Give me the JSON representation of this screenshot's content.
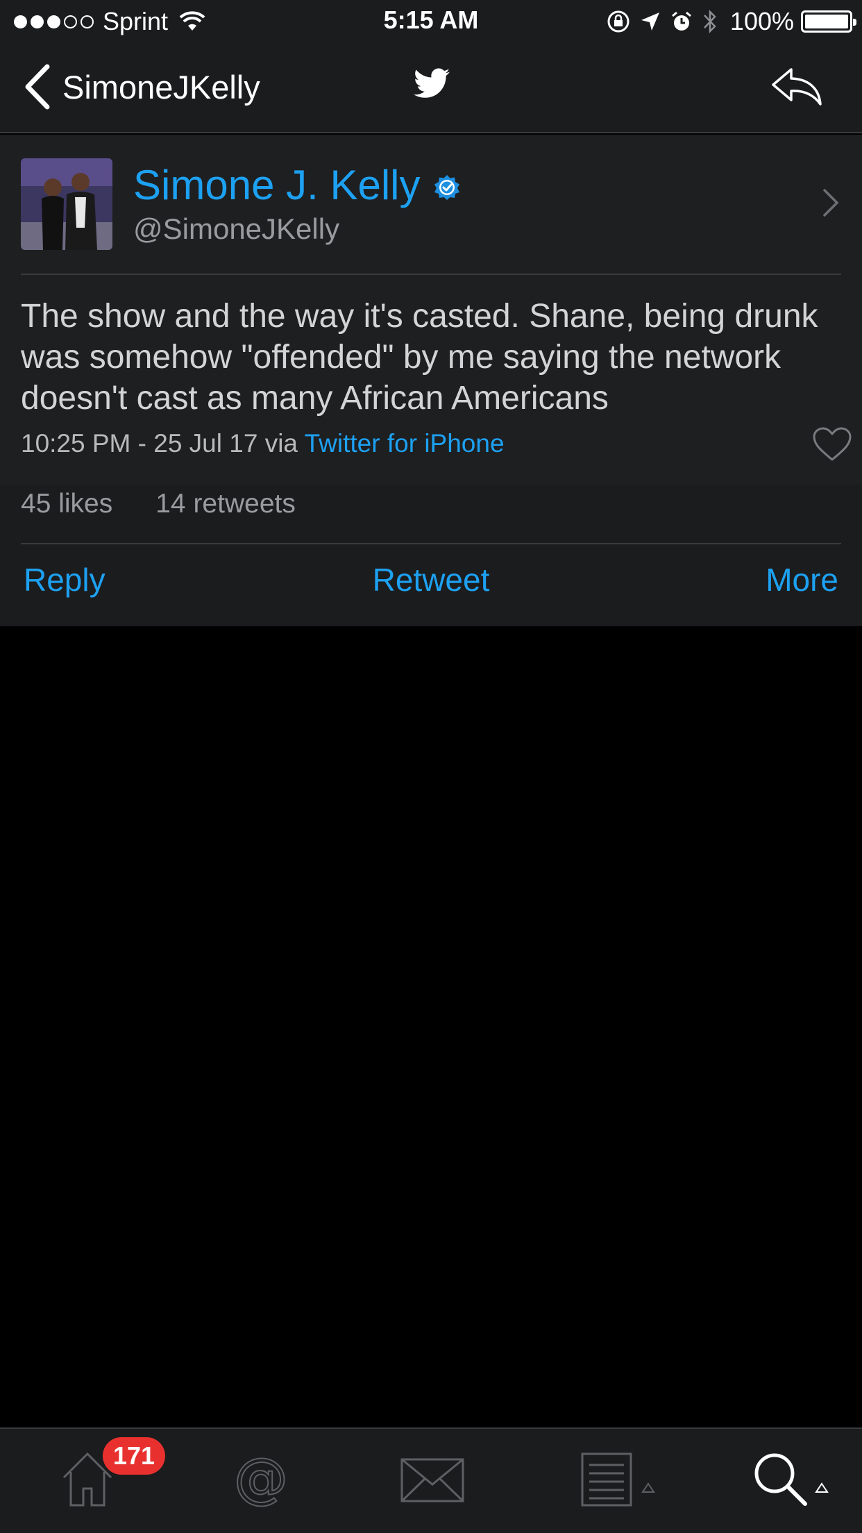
{
  "status_bar": {
    "carrier": "Sprint",
    "time": "5:15 AM",
    "battery_percent": "100%",
    "signal_bars": 3,
    "signal_total": 5
  },
  "nav": {
    "back_label": "SimoneJKelly",
    "logo_icon": "twitter-bird-icon",
    "reply_icon": "reply-arrow-icon"
  },
  "tweet": {
    "display_name": "Simone J. Kelly",
    "handle": "@SimoneJKelly",
    "verified": true,
    "body": "The show and the way it's casted. Shane, being drunk was somehow \"offended\" by me saying the network doesn't cast as many African Americans",
    "timestamp": "10:25 PM - 25 Jul 17 via",
    "client": "Twitter for iPhone",
    "likes": "45 likes",
    "retweets": "14 retweets"
  },
  "actions": {
    "reply": "Reply",
    "retweet": "Retweet",
    "more": "More"
  },
  "tab_bar": {
    "home_badge": "171",
    "tabs": [
      "home-icon",
      "mentions-icon",
      "messages-icon",
      "lists-icon",
      "search-icon"
    ]
  },
  "colors": {
    "accent": "#1da1f2",
    "background": "#000000",
    "card": "#1e1f21",
    "badge": "#e8312f"
  }
}
